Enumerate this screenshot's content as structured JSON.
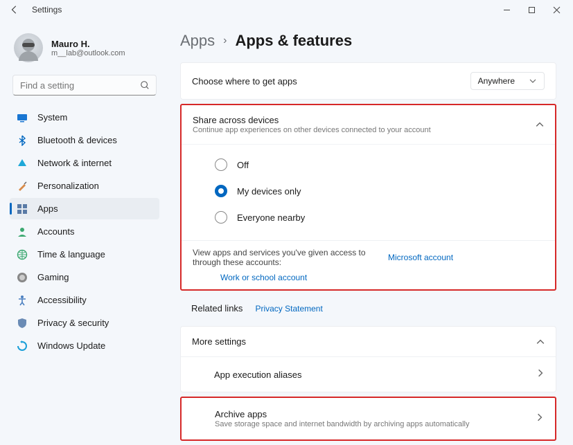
{
  "window": {
    "title": "Settings"
  },
  "profile": {
    "name": "Mauro H.",
    "email": "m__lab@outlook.com"
  },
  "search": {
    "placeholder": "Find a setting"
  },
  "nav": {
    "items": [
      {
        "label": "System"
      },
      {
        "label": "Bluetooth & devices"
      },
      {
        "label": "Network & internet"
      },
      {
        "label": "Personalization"
      },
      {
        "label": "Apps"
      },
      {
        "label": "Accounts"
      },
      {
        "label": "Time & language"
      },
      {
        "label": "Gaming"
      },
      {
        "label": "Accessibility"
      },
      {
        "label": "Privacy & security"
      },
      {
        "label": "Windows Update"
      }
    ]
  },
  "breadcrumb": {
    "parent": "Apps",
    "current": "Apps & features"
  },
  "getApps": {
    "label": "Choose where to get apps",
    "value": "Anywhere"
  },
  "share": {
    "title": "Share across devices",
    "sub": "Continue app experiences on other devices connected to your account",
    "options": [
      {
        "label": "Off"
      },
      {
        "label": "My devices only"
      },
      {
        "label": "Everyone nearby"
      }
    ],
    "accessText": "View apps and services you've given access to through these accounts:",
    "link1": "Microsoft account",
    "link2": "Work or school account"
  },
  "related": {
    "label": "Related links",
    "privacy": "Privacy Statement"
  },
  "more": {
    "title": "More settings",
    "aliases": "App execution aliases",
    "archive": {
      "title": "Archive apps",
      "sub": "Save storage space and internet bandwidth by archiving apps automatically"
    }
  }
}
